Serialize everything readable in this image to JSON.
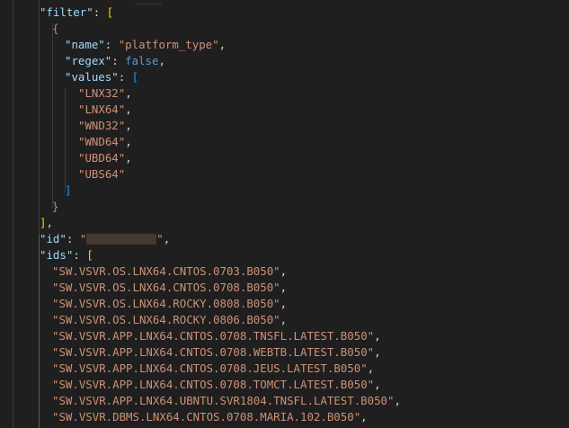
{
  "code": {
    "filter_key": "\"filter\"",
    "name_key": "\"name\"",
    "name_value": "\"platform_type\"",
    "regex_key": "\"regex\"",
    "regex_value": "false",
    "values_key": "\"values\"",
    "values": [
      "\"LNX32\"",
      "\"LNX64\"",
      "\"WND32\"",
      "\"WND64\"",
      "\"UBD64\"",
      "\"UBS64\""
    ],
    "id_key": "\"id\"",
    "id_value_open": "\"",
    "id_value_close": "\"",
    "ids_key": "\"ids\"",
    "ids": [
      "\"SW.VSVR.OS.LNX64.CNTOS.0703.B050\"",
      "\"SW.VSVR.OS.LNX64.CNTOS.0708.B050\"",
      "\"SW.VSVR.OS.LNX64.ROCKY.0808.B050\"",
      "\"SW.VSVR.OS.LNX64.ROCKY.0806.B050\"",
      "\"SW.VSVR.APP.LNX64.CNTOS.0708.TNSFL.LATEST.B050\"",
      "\"SW.VSVR.APP.LNX64.CNTOS.0708.WEBTB.LATEST.B050\"",
      "\"SW.VSVR.APP.LNX64.CNTOS.0708.JEUS.LATEST.B050\"",
      "\"SW.VSVR.APP.LNX64.CNTOS.0708.TOMCT.LATEST.B050\"",
      "\"SW.VSVR.APP.LNX64.UBNTU.SVR1804.TNSFL.LATEST.B050\"",
      "\"SW.VSVR.DBMS.LNX64.CNTOS.0708.MARIA.102.B050\""
    ]
  },
  "colors": {
    "background": "#1f1f1f",
    "key": "#9cdcfe",
    "string": "#ce9178",
    "keyword": "#569cd6",
    "bracket_level1": "#ffd700",
    "bracket_level2": "#da70d6",
    "bracket_level3": "#179fff",
    "redaction": "#463733"
  }
}
